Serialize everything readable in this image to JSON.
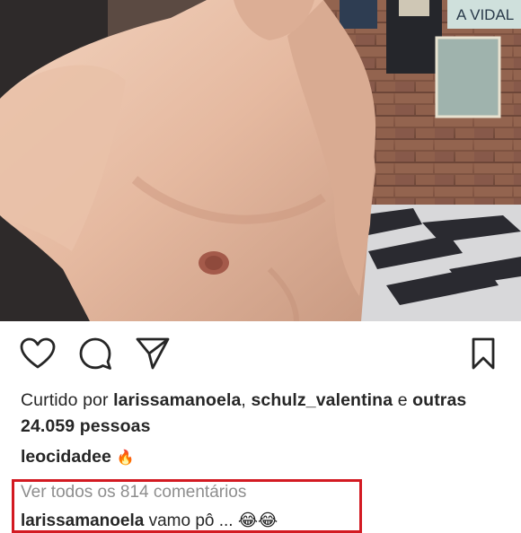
{
  "post": {
    "image_alt": "shirtless selfie in front of brick wall",
    "wall_poster_text": "A VIDAL"
  },
  "actions": {
    "like_icon": "heart-outline-icon",
    "comment_icon": "comment-bubble-icon",
    "share_icon": "paper-plane-icon",
    "save_icon": "bookmark-outline-icon"
  },
  "likes": {
    "prefix": "Curtido por",
    "user1": "larissamanoela",
    "separator": ",",
    "user2": "schulz_valentina",
    "conjunction": "e",
    "others": "outras 24.059 pessoas"
  },
  "caption": {
    "username": "leocidadee",
    "text": "🔥"
  },
  "comments": {
    "view_all": "Ver todos os 814 comentários",
    "preview_user": "larissamanoela",
    "preview_text": "vamo pô ... 😂😂"
  },
  "colors": {
    "highlight_border": "#d31a22",
    "text_primary": "#262626",
    "text_secondary": "#8e8e8e"
  }
}
